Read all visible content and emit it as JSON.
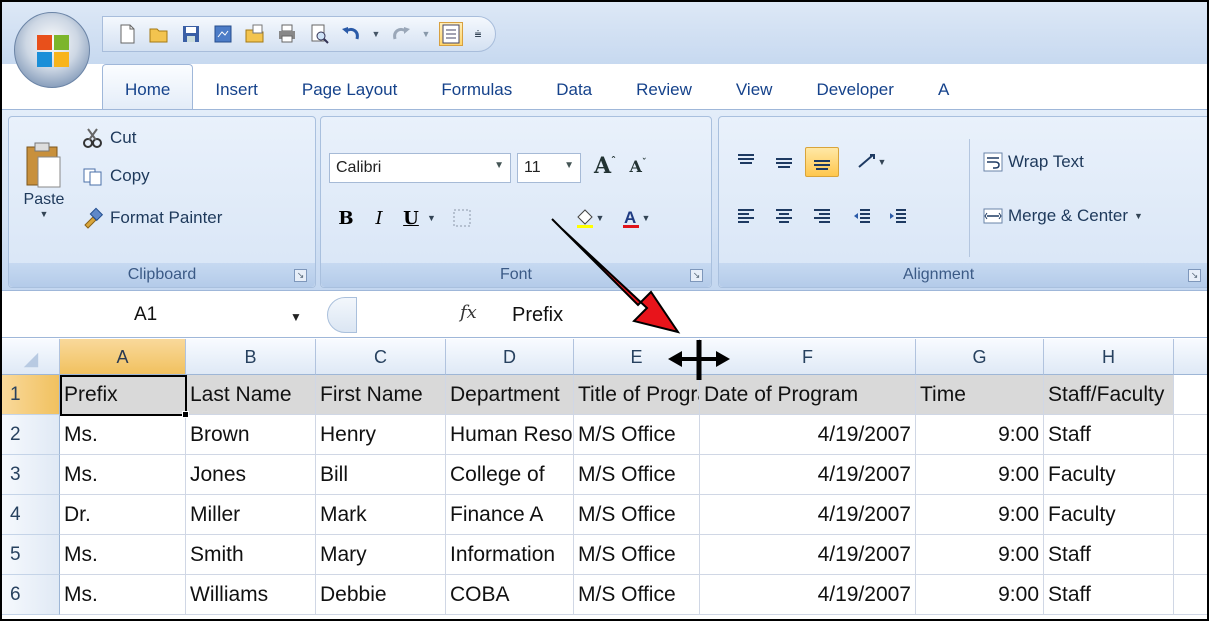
{
  "tabs": [
    "Home",
    "Insert",
    "Page Layout",
    "Formulas",
    "Data",
    "Review",
    "View",
    "Developer",
    "A"
  ],
  "clipboard": {
    "paste_label": "Paste",
    "cut_label": "Cut",
    "copy_label": "Copy",
    "format_painter_label": "Format Painter",
    "group_label": "Clipboard"
  },
  "font": {
    "font_name": "Calibri",
    "font_size": "11",
    "group_label": "Font",
    "bold": "B",
    "italic": "I",
    "underline": "U"
  },
  "alignment": {
    "wrap_text_label": "Wrap Text",
    "merge_center_label": "Merge & Center",
    "group_label": "Alignment"
  },
  "formula_bar": {
    "name_box": "A1",
    "fx": "fx",
    "value": "Prefix"
  },
  "grid": {
    "columns": [
      "A",
      "B",
      "C",
      "D",
      "E",
      "F",
      "G",
      "H"
    ],
    "rows": [
      {
        "num": "1",
        "cells": [
          "Prefix",
          "Last Name",
          "First Name",
          "Department",
          "Title of Program",
          "Date of Program",
          "Time",
          "Staff/Faculty"
        ]
      },
      {
        "num": "2",
        "cells": [
          "Ms.",
          "Brown",
          "Henry",
          "Human Resources",
          "M/S Office",
          "4/19/2007",
          "9:00",
          "Staff"
        ]
      },
      {
        "num": "3",
        "cells": [
          "Ms.",
          "Jones",
          "Bill",
          "College of",
          "M/S Office",
          "4/19/2007",
          "9:00",
          "Faculty"
        ]
      },
      {
        "num": "4",
        "cells": [
          "Dr.",
          "Miller",
          "Mark",
          "Finance A",
          "M/S Office",
          "4/19/2007",
          "9:00",
          "Faculty"
        ]
      },
      {
        "num": "5",
        "cells": [
          "Ms.",
          "Smith",
          "Mary",
          "Information",
          "M/S Office",
          "4/19/2007",
          "9:00",
          "Staff"
        ]
      },
      {
        "num": "6",
        "cells": [
          "Ms.",
          "Williams",
          "Debbie",
          "COBA",
          "M/S Office",
          "4/19/2007",
          "9:00",
          "Staff"
        ]
      }
    ]
  },
  "colors": {
    "ribbon": "#d5e3f5",
    "selected_header": "#f1c15f",
    "annotation_arrow": "#e8141b"
  }
}
